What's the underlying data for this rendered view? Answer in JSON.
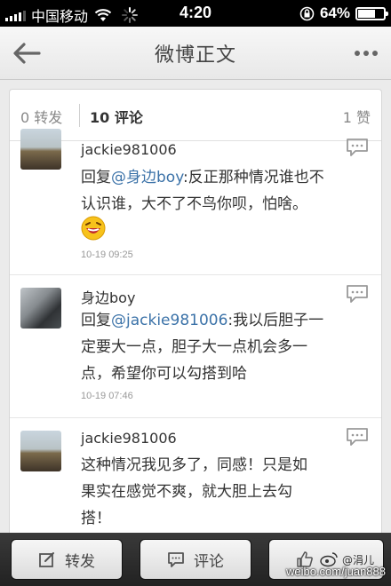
{
  "status_bar": {
    "carrier": "中国移动",
    "time": "4:20",
    "battery": "64%"
  },
  "nav": {
    "title": "微博正文",
    "back_icon": "back-arrow-icon",
    "more_icon": "more-dots-icon"
  },
  "stats": {
    "reposts_count": "0",
    "reposts_label": "转发",
    "comments_count": "10",
    "comments_label": "评论",
    "likes_count": "1",
    "likes_label": "赞"
  },
  "comments": [
    {
      "username": "jackie981006",
      "text_prefix": "回复",
      "mention": "@身边boy",
      "text_line1": ":反正那种情况谁也不",
      "text_line2": "认识谁，大不了不鸟你呗，怕啥。",
      "emoji": "laughing-emoji-icon",
      "time": "10-19 09:25"
    },
    {
      "username": "身边boy",
      "text_prefix": "回复",
      "mention": "@jackie981006",
      "text_line1": ":我以后胆子一",
      "text_line2": "定要大一点，胆子大一点机会多一",
      "text_line3": "点，希望你可以勾搭到哈",
      "time": "10-19 07:46"
    },
    {
      "username": "jackie981006",
      "text_line1": "这种情况我见多了，同感！只是如",
      "text_line2": "果实在感觉不爽，就大胆上去勾",
      "text_line3": "搭！"
    }
  ],
  "toolbar": {
    "repost_label": "转发",
    "comment_label": "评论"
  },
  "watermark": {
    "handle": "@涓儿",
    "url": "weibo.com/juan888"
  },
  "colors": {
    "mention": "#3b72a8",
    "text": "#333333",
    "toolbar": "#2a2a2a"
  }
}
